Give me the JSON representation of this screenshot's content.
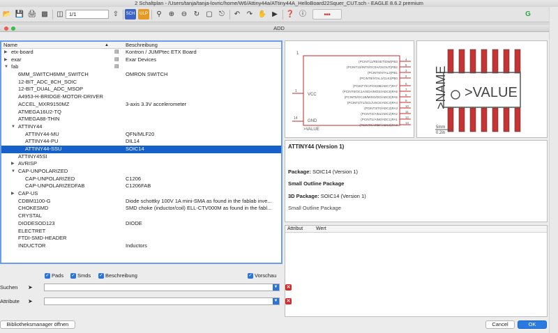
{
  "window": {
    "title": "2 Schaltplan - /Users/tanja/tanja-lovric/home/W6/Attiny44a/ATtiny44A_HelloBoard22Squer_CUT.sch - EAGLE 8.6.2 premium"
  },
  "toolbar": {
    "sheet_value": "1/1"
  },
  "dialog": {
    "title": "ADD"
  },
  "tree": {
    "col_name": "Name",
    "col_desc": "Beschreibung",
    "rows": [
      {
        "name": "etx-board",
        "desc": "Kontron / JUMPtec ETX Board",
        "level": 0,
        "arrow": "right",
        "lib": true
      },
      {
        "name": "exar",
        "desc": "Exar Devices",
        "level": 0,
        "arrow": "right",
        "lib": true
      },
      {
        "name": "fab",
        "desc": "",
        "level": 0,
        "arrow": "down",
        "lib": true
      },
      {
        "name": "6MM_SWITCH6MM_SWITCH",
        "desc": "OMRON SWITCH",
        "level": 1,
        "arrow": "",
        "lib": false
      },
      {
        "name": "12-BIT_ADC_8CH_SOIC",
        "desc": "",
        "level": 1,
        "arrow": "",
        "lib": false
      },
      {
        "name": "12-BIT_DUAL_ADC_MSOP",
        "desc": "",
        "level": 1,
        "arrow": "",
        "lib": false
      },
      {
        "name": "A4953-H-BRIDGE-MOTOR-DRIVER",
        "desc": "",
        "level": 1,
        "arrow": "",
        "lib": false
      },
      {
        "name": "ACCEL_MXR9150MZ",
        "desc": "3-axis 3.3V accelerometer",
        "level": 1,
        "arrow": "",
        "lib": false
      },
      {
        "name": "ATMEGA16U2-TQ",
        "desc": "",
        "level": 1,
        "arrow": "",
        "lib": false
      },
      {
        "name": "ATMEGA88-THIN",
        "desc": "",
        "level": 1,
        "arrow": "",
        "lib": false
      },
      {
        "name": "ATTINY44",
        "desc": "",
        "level": 1,
        "arrow": "down",
        "lib": false
      },
      {
        "name": "ATTINY44-MU",
        "desc": "QFN/MLF20",
        "level": 2,
        "arrow": "",
        "lib": false
      },
      {
        "name": "ATTINY44-PU",
        "desc": "DIL14",
        "level": 2,
        "arrow": "",
        "lib": false
      },
      {
        "name": "ATTINY44-SSU",
        "desc": "SOIC14",
        "level": 2,
        "arrow": "",
        "lib": false,
        "selected": true
      },
      {
        "name": "ATTINY45SI",
        "desc": "",
        "level": 1,
        "arrow": "",
        "lib": false
      },
      {
        "name": "AVRISP",
        "desc": "",
        "level": 1,
        "arrow": "right",
        "lib": false
      },
      {
        "name": "CAP-UNPOLARIZED",
        "desc": "",
        "level": 1,
        "arrow": "down",
        "lib": false
      },
      {
        "name": "CAP-UNPOLARIZED",
        "desc": "C1206",
        "level": 2,
        "arrow": "",
        "lib": false
      },
      {
        "name": "CAP-UNPOLARIZEDFAB",
        "desc": "C1206FAB",
        "level": 2,
        "arrow": "",
        "lib": false
      },
      {
        "name": "CAP-US",
        "desc": "",
        "level": 1,
        "arrow": "right",
        "lib": false
      },
      {
        "name": "CDBM1100-G",
        "desc": "Diode schottky 100V 1A mini-SMA as found in the fablab inve...",
        "level": 1,
        "arrow": "",
        "lib": false
      },
      {
        "name": "CHOKESMD",
        "desc": "SMD choke (inductor/coil) ELL-CTV000M as found in the fabl...",
        "level": 1,
        "arrow": "",
        "lib": false
      },
      {
        "name": "CRYSTAL",
        "desc": "",
        "level": 1,
        "arrow": "",
        "lib": false
      },
      {
        "name": "DIODESOD123",
        "desc": "DIODE",
        "level": 1,
        "arrow": "",
        "lib": false
      },
      {
        "name": "ELECTRET",
        "desc": "",
        "level": 1,
        "arrow": "",
        "lib": false
      },
      {
        "name": "FTDI-SMD-HEADER",
        "desc": "",
        "level": 1,
        "arrow": "",
        "lib": false
      },
      {
        "name": "INDUCTOR",
        "desc": "Inductors",
        "level": 1,
        "arrow": "",
        "lib": false
      }
    ]
  },
  "symbol": {
    "ref": "1",
    "value_label": ">VALUE",
    "vcc": "VCC",
    "gnd": "GND",
    "vcc_pin": "1",
    "gnd_pin": "14",
    "pins": [
      {
        "label": "(PCINT11/RESET/DW)PB3",
        "num": "4"
      },
      {
        "label": "(PCINT10/INT0/OC0A/CKOUT)PB2",
        "num": "5"
      },
      {
        "label": "(PCINT9/XTAL2)PB1",
        "num": "3"
      },
      {
        "label": "(PCINT8/XTAL1/CLKI)PB0",
        "num": "2"
      },
      {
        "label": "(PCINT7/ICP/OC0B/ADC7)PA7",
        "num": "6"
      },
      {
        "label": "(PCINT6/OC1A/SDA/MOSI/ADC6)PA6",
        "num": "7"
      },
      {
        "label": "(PCINT5/OC1B/MISO/DO/ADC5)PA5",
        "num": "8"
      },
      {
        "label": "(PCINT4/T1/SCL/USCK/ADC4)PA4",
        "num": "9"
      },
      {
        "label": "(PCINT3/T0/ADC3)PA3",
        "num": "10"
      },
      {
        "label": "(PCINT2/AIN1/ADC2)PA2",
        "num": "11"
      },
      {
        "label": "(PCINT1/AIN0/ADC1)PA1",
        "num": "12"
      },
      {
        "label": "(PCINT0/AREF/ADC0)PA0",
        "num": "13"
      }
    ]
  },
  "footprint": {
    "name_label": ">NAME",
    "value_label": ">VALUE",
    "scale_mm": "5mm",
    "scale_in": "0.2in"
  },
  "info": {
    "title": "ATTINY44 (Version 1)",
    "package_label": "Package:",
    "package_value": "SOIC14 (Version 1)",
    "package_desc": "Small Outline Package",
    "package3d_label": "3D Package:",
    "package3d_value": "SOIC14 (Version 1)",
    "package3d_desc": "Small Outline Package"
  },
  "attributes": {
    "col_attr": "Attribut",
    "col_value": "Wert"
  },
  "options": {
    "pads": "Pads",
    "smds": "Smds",
    "beschreibung": "Beschreibung",
    "vorschau": "Vorschau"
  },
  "search": {
    "suchen_label": "Suchen",
    "attribute_label": "Attribute",
    "suchen_value": "",
    "attribute_value": ""
  },
  "buttons": {
    "library_manager": "Bibliotheksmanager öffnen",
    "cancel": "Cancel",
    "ok": "OK"
  },
  "colors": {
    "selection": "#1560c9",
    "focus_border": "#6a9ee8",
    "pad_red": "#c83232",
    "ok_blue": "#2a7ae2"
  }
}
